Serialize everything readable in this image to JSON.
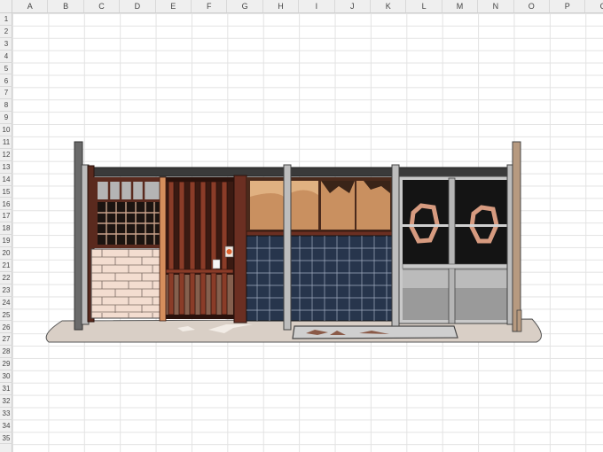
{
  "spreadsheet": {
    "columns": [
      "A",
      "B",
      "C",
      "D",
      "E",
      "F",
      "G",
      "H",
      "I",
      "J",
      "K",
      "L",
      "M",
      "N",
      "O",
      "P",
      "Q"
    ],
    "rows": [
      "1",
      "2",
      "3",
      "4",
      "5",
      "6",
      "7",
      "8",
      "9",
      "10",
      "11",
      "12",
      "13",
      "14",
      "15",
      "16",
      "17",
      "18",
      "19",
      "20",
      "21",
      "22",
      "23",
      "24",
      "25",
      "26",
      "27",
      "28",
      "29",
      "30",
      "31",
      "32",
      "33",
      "34",
      "35"
    ]
  },
  "drawing": {
    "colors": {
      "roof": "#3a3a3a",
      "wood_dark": "#5a2a1e",
      "wood_frame": "#6b2f22",
      "lattice": "#8a3c28",
      "pillar": "#b9b9b9",
      "ground": "#d9cfc6",
      "tile_wall": "#f3ddd0",
      "noren": "#27354c",
      "glass_warm": "#c99060",
      "door_glass": "#9a9a9a",
      "mat": "#c9c9c9"
    }
  }
}
